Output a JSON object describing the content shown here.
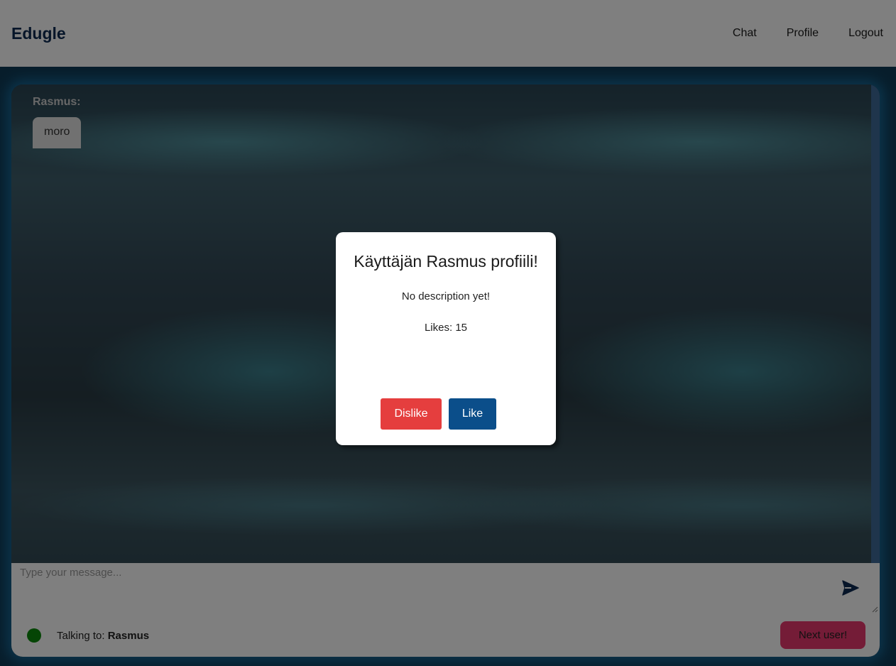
{
  "navbar": {
    "brand": "Edugle",
    "links": [
      {
        "label": "Chat"
      },
      {
        "label": "Profile"
      },
      {
        "label": "Logout"
      }
    ]
  },
  "chat": {
    "messages": [
      {
        "sender": "Rasmus:",
        "text": "moro"
      }
    ],
    "input_placeholder": "Type your message...",
    "status_prefix": "Talking to: ",
    "status_user": "Rasmus",
    "next_label": "Next user!",
    "status_color": "#0a8a0a"
  },
  "modal": {
    "title": "Käyttäjän Rasmus profiili!",
    "description": "No description yet!",
    "likes_text": "Likes: 15",
    "dislike_label": "Dislike",
    "like_label": "Like"
  },
  "colors": {
    "brand": "#0c2a52",
    "dislike": "#e53e3e",
    "like": "#0b4e8a",
    "next_user": "#e8386e"
  }
}
